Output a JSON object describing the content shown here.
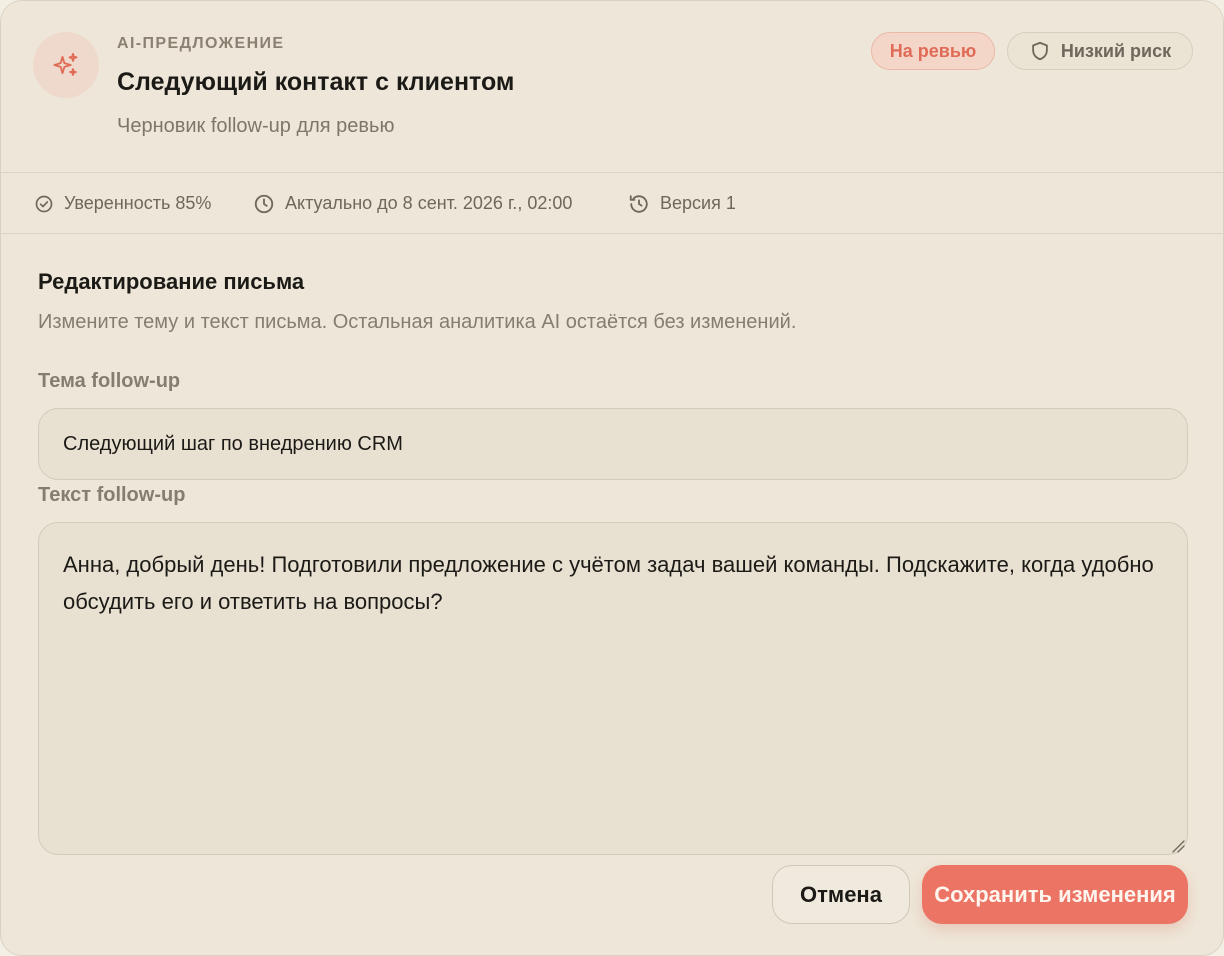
{
  "header": {
    "eyebrow": "AI-ПРЕДЛОЖЕНИЕ",
    "title": "Следующий контакт с клиентом",
    "subtitle": "Черновик follow-up для ревью",
    "badges": {
      "review": "На ревью",
      "risk": "Низкий риск"
    }
  },
  "meta": {
    "confidence": "Уверенность 85%",
    "valid_until": "Актуально до 8 сент. 2026 г., 02:00",
    "version": "Версия 1"
  },
  "editor": {
    "title": "Редактирование письма",
    "description": "Измените тему и текст письма. Остальная аналитика AI остаётся без изменений.",
    "subject_label": "Тема follow-up",
    "subject_value": "Следующий шаг по внедрению CRM",
    "body_label": "Текст follow-up",
    "body_value": "Анна, добрый день! Подготовили предложение с учётом задач вашей команды. Подскажите, когда удобно обсудить его и ответить на вопросы?"
  },
  "actions": {
    "cancel": "Отмена",
    "save": "Сохранить изменения"
  },
  "icons": {
    "ai": "sparkles-icon",
    "risk": "shield-icon",
    "confidence": "check-circle-icon",
    "valid_until": "clock-icon",
    "version": "history-icon"
  },
  "colors": {
    "accent": "#ec7464",
    "review_text": "#e06b57",
    "background": "#eee7d9"
  }
}
